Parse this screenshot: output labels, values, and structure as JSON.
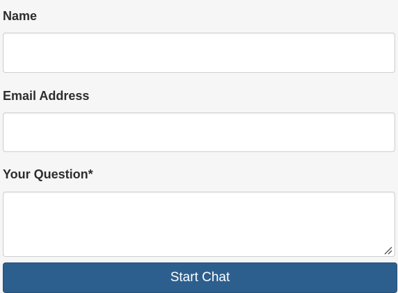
{
  "form": {
    "name_label": "Name",
    "name_value": "",
    "email_label": "Email Address",
    "email_value": "",
    "question_label": "Your Question*",
    "question_value": "",
    "submit_label": "Start Chat"
  },
  "colors": {
    "button_bg": "#2d5f8e",
    "page_bg": "#f6f6f6"
  }
}
